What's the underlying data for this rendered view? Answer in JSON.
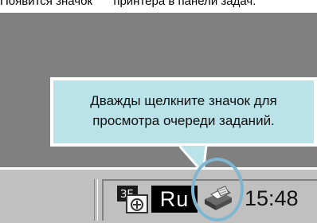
{
  "top_strip": {
    "text_before": "Появится значок ",
    "text_after": " принтера в панели задач."
  },
  "tooltip": {
    "line1": "Дважды щелкните  значок для",
    "line2": "просмотра очереди заданий."
  },
  "taskbar": {
    "language": "Ru",
    "clock": "15:48",
    "ime_label": "ЗЕ"
  },
  "colors": {
    "desktop": "#808080",
    "taskbar": "#c0c0c0",
    "tooltip_bg": "#b9e2e9",
    "highlight": "#7fb6d2"
  }
}
